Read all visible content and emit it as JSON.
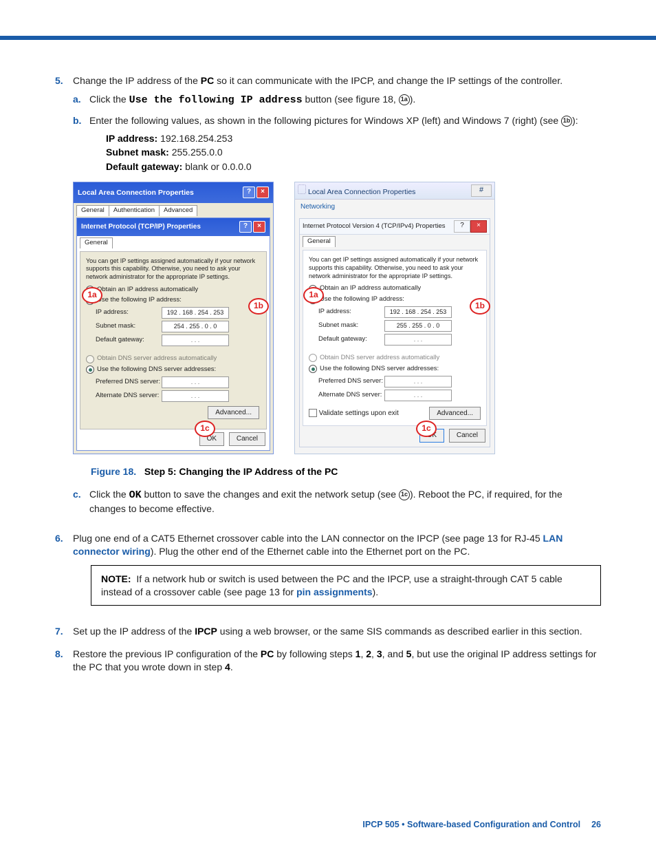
{
  "steps": {
    "s5": {
      "text_a": "Change the IP address of the ",
      "pc": "PC",
      "text_b": " so it can communicate with the IPCP, and change the IP settings of the controller.",
      "a": {
        "pre": "Click the ",
        "btn": "Use the following IP address",
        "post": " button (see figure 18, ",
        "circ": "1a",
        "end": ")."
      },
      "b": {
        "text": "Enter the following values, as shown in the following pictures for Windows XP (left) and Windows 7 (right) (see ",
        "circ": "1b",
        "end": "):",
        "ip_lbl": "IP address:",
        "ip_val": " 192.168.254.253",
        "sn_lbl": "Subnet mask:",
        "sn_val": " 255.255.0.0",
        "gw_lbl": "Default gateway:",
        "gw_val": " blank or 0.0.0.0"
      },
      "c": {
        "pre": "Click the ",
        "ok": "OK",
        "mid": " button to save the changes and exit the network setup (see ",
        "circ": "1c",
        "post": "). Reboot the PC, if required, for the changes to become effective."
      }
    },
    "s6": {
      "text_a": "Plug one end of a CAT5 Ethernet crossover cable into the LAN connector on the IPCP (see page 13 for RJ-45 ",
      "link": "LAN connector wiring",
      "text_b": "). Plug the other end of the Ethernet cable into the Ethernet port on the PC."
    },
    "note": {
      "lbl": "NOTE:",
      "text_a": "If a network hub or switch is used between the PC and the IPCP, use a straight-through CAT 5 cable instead of a crossover cable (see page 13 for ",
      "link": "pin assignments",
      "text_b": ")."
    },
    "s7": {
      "text_a": "Set up the IP address of the ",
      "ipcp": "IPCP",
      "text_b": " using a web browser, or the same SIS commands as described earlier in this section."
    },
    "s8": {
      "text_a": "Restore the previous IP configuration of the ",
      "pc": "PC",
      "text_b": " by following steps ",
      "n1": "1",
      "n2": "2",
      "n3": "3",
      "n5": "5",
      "text_c": ", but use the original IP address settings for the PC that you wrote down in step ",
      "n4": "4",
      "dot": "."
    }
  },
  "fig": {
    "label": "Figure 18.",
    "title": "Step 5: Changing the IP Address of the ",
    "pc": "PC"
  },
  "xp": {
    "outer_title": "Local Area Connection Properties",
    "tab1": "General",
    "tab2": "Authentication",
    "tab3": "Advanced",
    "inner_title": "Internet Protocol (TCP/IP) Properties",
    "tab_general": "General",
    "desc": "You can get IP settings assigned automatically if your network supports this capability. Otherwise, you need to ask your network administrator for the appropriate IP settings.",
    "r_auto": "Obtain an IP address automatically",
    "r_use": "Use the following IP address:",
    "ip_lbl": "IP address:",
    "ip": "192 . 168 . 254 . 253",
    "sn_lbl": "Subnet mask:",
    "sn": "254 . 255 .  0  .  0",
    "gw_lbl": "Default gateway:",
    "gw": " .       .       . ",
    "dns_auto": "Obtain DNS server address automatically",
    "dns_use": "Use the following DNS server addresses:",
    "pdns": "Preferred DNS server:",
    "adns": "Alternate DNS server:",
    "adv": "Advanced...",
    "ok": "OK",
    "cancel": "Cancel"
  },
  "w7": {
    "outer_title": "Local Area Connection Properties",
    "networking": "Networking",
    "inner_title": "Internet Protocol Version 4 (TCP/IPv4) Properties",
    "tab_general": "General",
    "desc": "You can get IP settings assigned automatically if your network supports this capability. Otherwise, you need to ask your network administrator for the appropriate IP settings.",
    "r_auto": "Obtain an IP address automatically",
    "r_use": "Use the following IP address:",
    "ip_lbl": "IP address:",
    "ip": "192 . 168 . 254 . 253",
    "sn_lbl": "Subnet mask:",
    "sn": "255 . 255 .  0  .  0",
    "gw_lbl": "Default gateway:",
    "gw": " .       .       . ",
    "dns_auto": "Obtain DNS server address automatically",
    "dns_use": "Use the following DNS server addresses:",
    "pdns": "Preferred DNS server:",
    "adns": "Alternate DNS server:",
    "validate": "Validate settings upon exit",
    "adv": "Advanced...",
    "ok": "OK",
    "cancel": "Cancel"
  },
  "callouts": {
    "a": "1a",
    "b": "1b",
    "c": "1c"
  },
  "footer": {
    "text": "IPCP 505 • Software-based Configuration and Control",
    "page": "26"
  }
}
